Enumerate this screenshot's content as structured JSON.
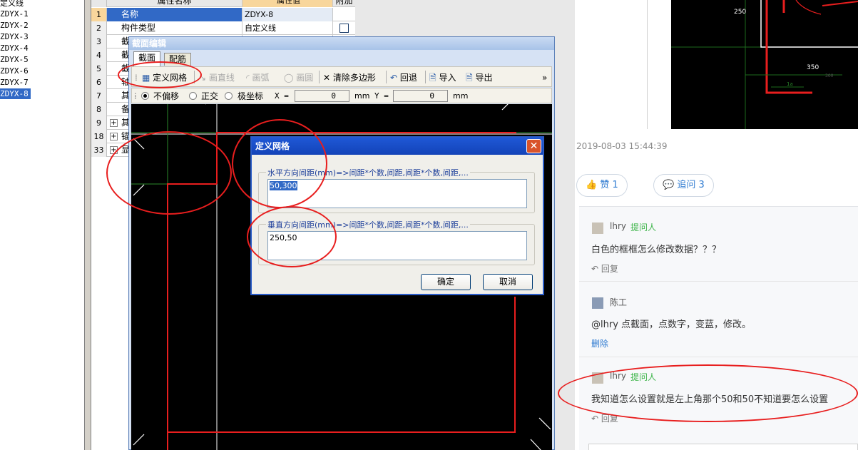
{
  "tree": {
    "items": [
      "定义线",
      "ZDYX-1",
      "ZDYX-2",
      "ZDYX-3",
      "ZDYX-4",
      "ZDYX-5",
      "ZDYX-6",
      "ZDYX-7",
      "ZDYX-8"
    ],
    "selected": "ZDYX-8"
  },
  "props": {
    "headers": [
      "属性名称",
      "属性值",
      "附加"
    ],
    "rows": [
      {
        "num": "1",
        "name": "名称",
        "value": "ZDYX-8",
        "checkbox": false,
        "expander": false
      },
      {
        "num": "2",
        "name": "构件类型",
        "value": "自定义线",
        "checkbox": true,
        "expander": false
      },
      {
        "num": "3",
        "name": "截",
        "value": "",
        "checkbox": false,
        "expander": false
      },
      {
        "num": "4",
        "name": "截",
        "value": "",
        "checkbox": false,
        "expander": false
      },
      {
        "num": "5",
        "name": "截",
        "value": "",
        "checkbox": false,
        "expander": false
      },
      {
        "num": "6",
        "name": "轴",
        "value": "",
        "checkbox": false,
        "expander": false
      },
      {
        "num": "7",
        "name": "其",
        "value": "",
        "checkbox": false,
        "expander": false
      },
      {
        "num": "8",
        "name": "备",
        "value": "",
        "checkbox": false,
        "expander": false
      },
      {
        "num": "9",
        "name": "其",
        "value": "",
        "checkbox": false,
        "expander": true
      },
      {
        "num": "18",
        "name": "锚",
        "value": "",
        "checkbox": false,
        "expander": true
      },
      {
        "num": "33",
        "name": "显",
        "value": "",
        "checkbox": false,
        "expander": true
      }
    ]
  },
  "section_editor": {
    "title": "截面编辑",
    "tabs": [
      "截面",
      "配筋"
    ],
    "toolbar": {
      "define_grid": "定义网格",
      "draw_line": "画直线",
      "draw_arc": "画弧",
      "draw_circle": "画圆",
      "clear_polygon": "清除多边形",
      "undo": "回退",
      "import": "导入",
      "export": "导出",
      "more": "»"
    },
    "coords": {
      "no_offset": "不偏移",
      "ortho": "正交",
      "polar": "极坐标",
      "x_label": "X =",
      "x_value": "0",
      "y_label": "Y =",
      "y_value": "0",
      "unit": "mm"
    }
  },
  "grid_dialog": {
    "title": "定义网格",
    "close": "✕",
    "horizontal_label": "水平方向间距(mm)=>间距*个数,间距,间距*个数,间距,...",
    "horizontal_value": "50,300",
    "vertical_label": "垂直方向间距(mm)=>间距*个数,间距,间距*个数,间距,...",
    "vertical_value": "250,50",
    "ok": "确定",
    "cancel": "取消"
  },
  "right_image": {
    "label_250": "250",
    "label_350": "350",
    "label_1a": "1a",
    "label_small": "300"
  },
  "post": {
    "timestamp": "2019-08-03 15:44:39",
    "like": "赞 1",
    "follow": "追问 3"
  },
  "comments": [
    {
      "user": "lhry",
      "role": "提问人",
      "text": "白色的框框怎么修改数据？？？",
      "action": "回复"
    },
    {
      "user": "陈工",
      "role": "",
      "text": "@lhry 点截面，点数字，变蓝，修改。",
      "action": "删除"
    },
    {
      "user": "lhry",
      "role": "提问人",
      "text": "我知道怎么设置就是左上角那个50和50不知道要怎么设置",
      "action": "回复"
    }
  ],
  "colors": {
    "annotation": "#e81e1e",
    "selection": "#3169c6",
    "title_blue": "#1343b8",
    "link": "#2f7bd1",
    "role_green": "#3eb54a"
  }
}
